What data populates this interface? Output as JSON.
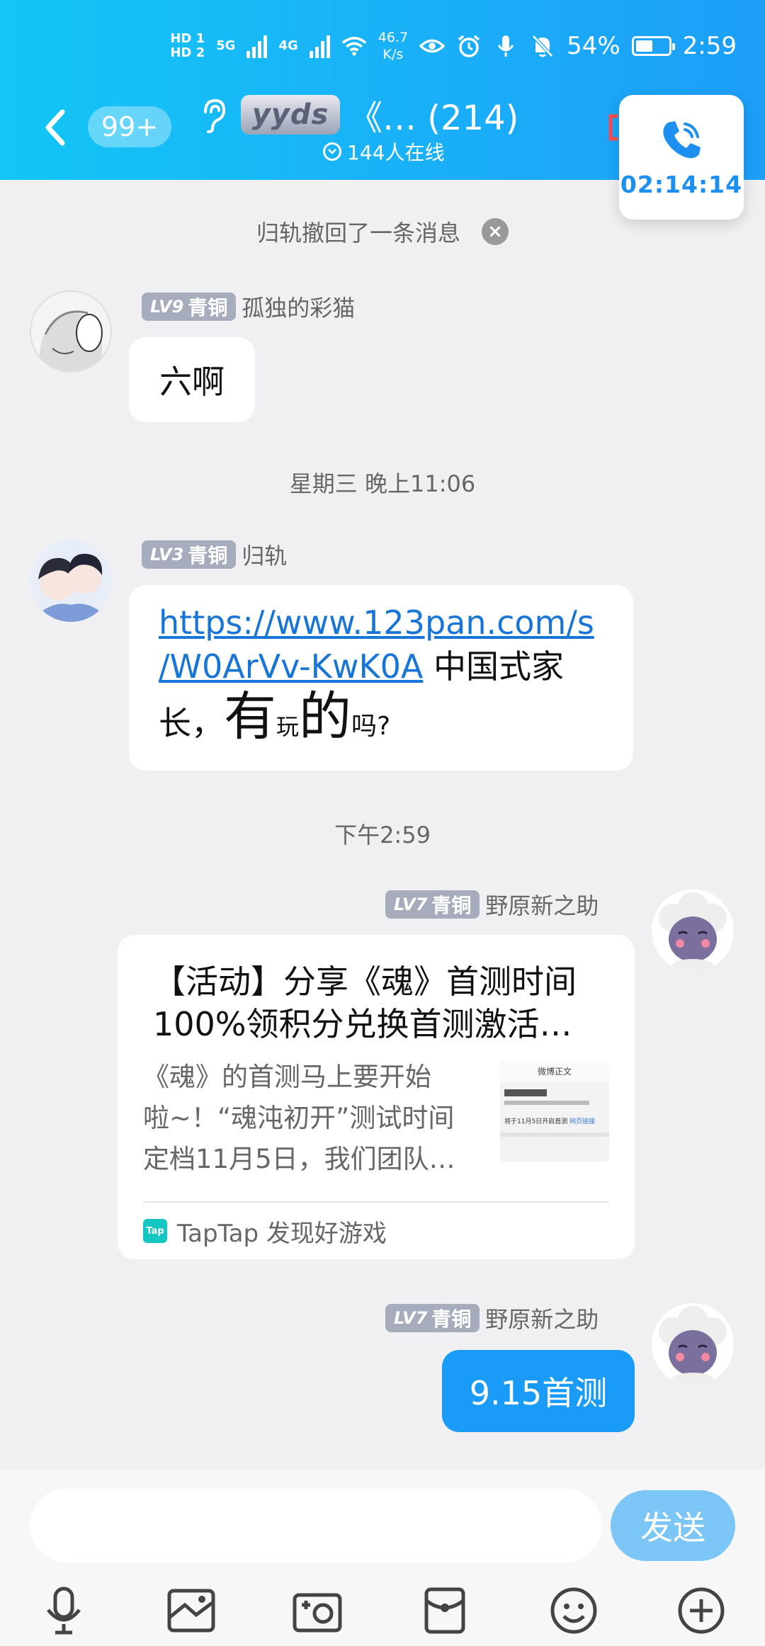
{
  "status_bar": {
    "hd1": "HD 1",
    "hd2": "HD 2",
    "net1": "5G",
    "net2": "4G",
    "speed_value": "46.7",
    "speed_unit": "K/s",
    "battery": "54%",
    "battery_level": 0.54,
    "time": "2:59"
  },
  "header": {
    "unread_badge": "99+",
    "group_logo_text": "yyds",
    "group_title": "《…  (214)",
    "online_status": "144人在线"
  },
  "call": {
    "timer": "02:14:14"
  },
  "recall_notice": "归轨撤回了一条消息",
  "messages": [
    {
      "level": "LV9",
      "rank": "青铜",
      "sender": "孤独的彩猫",
      "text": "六啊"
    },
    {
      "timestamp": "星期三 晚上11:06"
    },
    {
      "level": "LV3",
      "rank": "青铜",
      "sender": "归轨",
      "link_line1": "https://www.123pan.com/s",
      "link_line2": "/W0ArVv-KwK0A",
      "text_after_link": " 中国式家",
      "text_line3_a": "长，",
      "text_line3_b": "有",
      "text_line3_c": "玩",
      "text_line3_d": "的",
      "text_line3_e": "吗?"
    },
    {
      "timestamp": "下午2:59"
    },
    {
      "level": "LV7",
      "rank": "青铜",
      "sender": "野原新之助",
      "card_title_line1": "【活动】分享《魂》首测时间",
      "card_title_line2": "100%领积分兑换首测激活…",
      "card_desc_line1": "《魂》的首测马上要开始",
      "card_desc_line2": "啦~！“魂沌初开”测试时间",
      "card_desc_line3": "定档11月5日，我们团队…",
      "thumb_title": "微博正文",
      "thumb_text": "将于11月5日开启首测",
      "thumb_link": "网页链接",
      "source_icon": "Tap",
      "source": "TapTap 发现好游戏"
    },
    {
      "level": "LV7",
      "rank": "青铜",
      "sender": "野原新之助",
      "text": "9.15首测"
    }
  ],
  "composer": {
    "placeholder": "",
    "send_label": "发送"
  },
  "icons": {
    "toolbar": [
      "microphone-icon",
      "image-icon",
      "camera-icon",
      "red-packet-icon",
      "emoji-icon",
      "plus-icon"
    ]
  },
  "colors": {
    "header_gradient_start": "#13c6f5",
    "header_gradient_end": "#1d9ef8",
    "own_bubble": "#1a9bf7",
    "send_button": "#7cc6f7",
    "level_badge": "#a7acbc",
    "link": "#1875d8",
    "call_timer": "#1d8ff0"
  }
}
